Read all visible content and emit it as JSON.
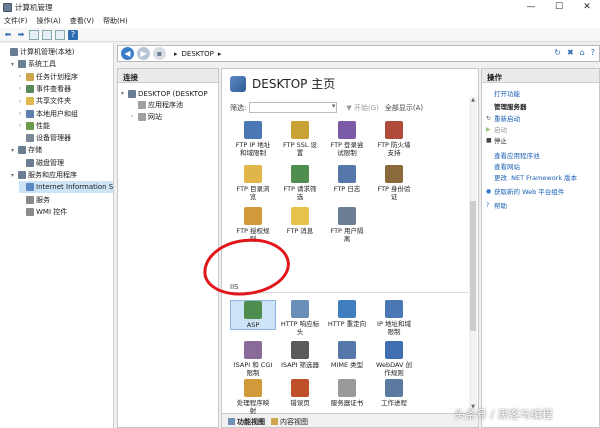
{
  "window": {
    "title": "计算机管理",
    "controls": [
      "—",
      "☐",
      "✕"
    ]
  },
  "menu": [
    "文件(F)",
    "操作(A)",
    "查看(V)",
    "帮助(H)"
  ],
  "tree": {
    "items": [
      {
        "label": "计算机管理(本地)",
        "indent": 0,
        "arrow": "",
        "color": "#6a7d92"
      },
      {
        "label": "系统工具",
        "indent": 1,
        "arrow": "▾",
        "color": "#6a7d92"
      },
      {
        "label": "任务计划程序",
        "indent": 2,
        "arrow": "›",
        "color": "#d0a64a"
      },
      {
        "label": "事件查看器",
        "indent": 2,
        "arrow": "›",
        "color": "#5a8a5a"
      },
      {
        "label": "共享文件夹",
        "indent": 2,
        "arrow": "›",
        "color": "#e1b84c"
      },
      {
        "label": "本地用户和组",
        "indent": 2,
        "arrow": "›",
        "color": "#5f7fb0"
      },
      {
        "label": "性能",
        "indent": 2,
        "arrow": "›",
        "color": "#6b9b4c"
      },
      {
        "label": "设备管理器",
        "indent": 2,
        "arrow": "",
        "color": "#7a8898"
      },
      {
        "label": "存储",
        "indent": 1,
        "arrow": "▾",
        "color": "#6a7d92"
      },
      {
        "label": "磁盘管理",
        "indent": 2,
        "arrow": "",
        "color": "#6a7d92"
      },
      {
        "label": "服务和应用程序",
        "indent": 1,
        "arrow": "▾",
        "color": "#6a7d92"
      },
      {
        "label": "Internet Information S",
        "indent": 2,
        "arrow": "",
        "color": "#5b8bc7",
        "selected": true
      },
      {
        "label": "服务",
        "indent": 2,
        "arrow": "",
        "color": "#8a8a8a"
      },
      {
        "label": "WMI 控件",
        "indent": 2,
        "arrow": "",
        "color": "#8a8a8a"
      }
    ]
  },
  "address": {
    "crumb": "DESKTOP",
    "sep": "▸"
  },
  "connections": {
    "header": "连接",
    "items": [
      {
        "label": "DESKTOP (DESKTOP",
        "indent": 0,
        "arrow": "▾",
        "color": "#6a7d92"
      },
      {
        "label": "应用程序池",
        "indent": 1,
        "arrow": "",
        "color": "#a0a0a0"
      },
      {
        "label": "网站",
        "indent": 1,
        "arrow": "›",
        "color": "#a0a0a0"
      }
    ]
  },
  "main": {
    "title": "DESKTOP 主页",
    "filter_label": "筛选:",
    "go_label": "▼ 开始(G)",
    "show_all": "全部显示(A)",
    "section": "IIS",
    "tiles": [
      {
        "label": "FTP IP 地址\n和域限制",
        "color": "#4a78b4"
      },
      {
        "label": "FTP SSL 设\n置",
        "color": "#c9a235"
      },
      {
        "label": "FTP 登录尝\n试限制",
        "color": "#7b5aa8"
      },
      {
        "label": "FTP 防火墙\n支持",
        "color": "#b04a3a"
      },
      {
        "label": "FTP 目录浏\n览",
        "color": "#e0b64a"
      },
      {
        "label": "FTP 请求筛\n选",
        "color": "#4f8d4f"
      },
      {
        "label": "FTP 日志",
        "color": "#5577aa"
      },
      {
        "label": "FTP 身份验\n证",
        "color": "#8a6a3a"
      },
      {
        "label": "FTP 授权规\n则",
        "color": "#d0993a"
      },
      {
        "label": "FTP 消息",
        "color": "#e6c34a"
      },
      {
        "label": "FTP 用户隔\n离",
        "color": "#6a7d92"
      },
      {
        "label": "ASP",
        "color": "#4f8d4f"
      },
      {
        "label": "HTTP 响应标\n头",
        "color": "#6a8fb8"
      },
      {
        "label": "HTTP 重定向",
        "color": "#3f7fc0"
      },
      {
        "label": "IP 地址和域\n限制",
        "color": "#4a78b4"
      },
      {
        "label": "ISAPI 和 CGI\n限制",
        "color": "#8a6a9a"
      },
      {
        "label": "ISAPI 筛选器",
        "color": "#5a5a5a"
      },
      {
        "label": "MIME 类型",
        "color": "#5577aa"
      },
      {
        "label": "WebDAV 创\n作规则",
        "color": "#3f6fb0"
      },
      {
        "label": "处理程序映\n射",
        "color": "#d09a3a"
      },
      {
        "label": "错误页",
        "color": "#c0502a"
      },
      {
        "label": "服务器证书",
        "color": "#9a9a9a"
      },
      {
        "label": "工作进程",
        "color": "#5a7aa0"
      }
    ],
    "tabs": [
      "功能视图",
      "内容视图"
    ]
  },
  "actions": {
    "header": "操作",
    "items": [
      {
        "label": "打开功能",
        "kind": "link",
        "icon": ""
      },
      {
        "label": "管理服务器",
        "kind": "head",
        "icon": ""
      },
      {
        "label": "重新启动",
        "kind": "link",
        "icon": "↻"
      },
      {
        "label": "启动",
        "kind": "gray",
        "icon": "▶"
      },
      {
        "label": "停止",
        "kind": "plain",
        "icon": "■"
      },
      {
        "label": "查看应用程序池",
        "kind": "link",
        "icon": ""
      },
      {
        "label": "查看网站",
        "kind": "link",
        "icon": ""
      },
      {
        "label": "更改 .NET Framework 版本",
        "kind": "link",
        "icon": ""
      },
      {
        "label": "获取新的 Web 平台组件",
        "kind": "link",
        "icon": "●"
      },
      {
        "label": "帮助",
        "kind": "link",
        "icon": "?"
      }
    ]
  },
  "watermark": "头条号 / 黑客与编程"
}
